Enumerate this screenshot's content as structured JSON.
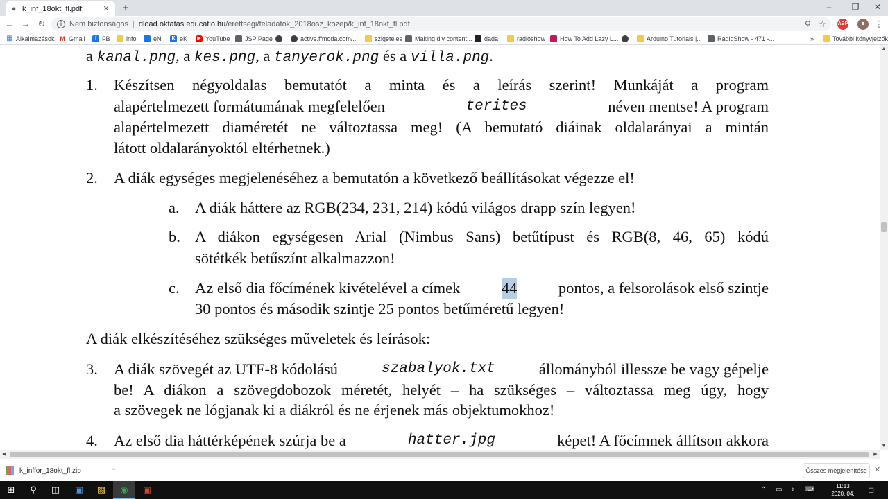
{
  "browser": {
    "tab_title": "k_inf_18okt_fl.pdf",
    "url_security": "Nem biztonságos",
    "url_host": "dload.oktatas.educatio.hu",
    "url_path": "/erettsegi/feladatok_2018osz_kozep/k_inf_18okt_fl.pdf",
    "bookmarks": [
      "Alkalmazások",
      "Gmail",
      "FB",
      "info",
      "eN",
      "eK",
      "YouTube",
      "JSP Page",
      "active.ffmoda.com/...",
      "szigeteles",
      "Making div content...",
      "dada",
      "radioshow",
      "How To Add Lazy L...",
      "Arduino Tutorials |...",
      "RadioShow - 471 -..."
    ],
    "other_bookmarks": "További könyvjelzők"
  },
  "document": {
    "line0": {
      "a1": "a ",
      "f1": "kanal.png",
      "a2": ", a ",
      "f2": "kes.png",
      "a3": ", a ",
      "f3": "tanyerok.png",
      "a4": " és a ",
      "f4": "villa.png",
      "a5": "."
    },
    "item1": {
      "num": "1.",
      "l1": "Készítsen négyoldalas bemutatót a minta és a leírás szerint! Munkáját a program",
      "l2a": "alapértelmezett formátumának megfelelően",
      "l2b": "terites",
      "l2c": "néven mentse! A program",
      "l3": "alapértelmezett diaméretét ne változtassa meg! (A bemutató diáinak oldalarányai a mintán",
      "l4": "látott oldalarányoktól eltérhetnek.)"
    },
    "item2": {
      "num": "2.",
      "l1": "A diák egységes megjelenéséhez a bemutatón a következő beállításokat végezze el!",
      "a_label": "a.",
      "a_l1": "A diák háttere az RGB(234, 231, 214) kódú világos drapp szín legyen!",
      "b_label": "b.",
      "b_l1": "A diákon egységesen Arial (Nimbus Sans) betűtípust és RGB(8, 46, 65) kódú",
      "b_l2": "sötétkék betűszínt alkalmazzon!",
      "c_label": "c.",
      "c_l1a": "Az első dia főcímének kivételével a címek",
      "c_l1hl": "44",
      "c_l1b": "pontos, a felsorolások első szintje",
      "c_l2": "30 pontos és második szintje 25 pontos betűméretű legyen!"
    },
    "section_heading": "A diák elkészítéséhez szükséges műveletek és leírások:",
    "item3": {
      "num": "3.",
      "l1a": "A diák szövegét az UTF-8 kódolású",
      "l1file": "szabalyok.txt",
      "l1b": "állományból illessze be vagy gépelje",
      "l2": "be! A diákon a szövegdobozok méretét, helyét – ha szükséges – változtassa meg úgy, hogy",
      "l3": "a szövegek ne lógjanak ki a diákról és ne érjenek más objektumokhoz!"
    },
    "item4": {
      "num": "4.",
      "l1a": "Az első dia háttérképének szúrja be a",
      "l1file": "hatter.jpg",
      "l1b": "képet! A főcímnek állítson akkora"
    }
  },
  "downloads": {
    "file": "k_inffor_18okt_fl.zip",
    "show_all": "Összes megjelenítése"
  },
  "taskbar": {
    "time": "11:13",
    "date": "2020. 04. 27."
  }
}
